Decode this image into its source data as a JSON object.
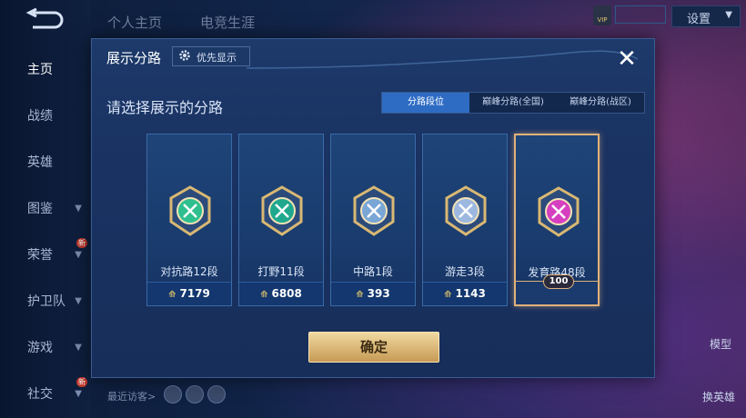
{
  "nav": {
    "top_tabs": [
      "个人主页",
      "电竞生涯"
    ],
    "sidebar": [
      {
        "label": "主页",
        "active": true,
        "chevron": false,
        "new": false
      },
      {
        "label": "战绩",
        "active": false,
        "chevron": false,
        "new": false
      },
      {
        "label": "英雄",
        "active": false,
        "chevron": false,
        "new": false
      },
      {
        "label": "图鉴",
        "active": false,
        "chevron": true,
        "new": false
      },
      {
        "label": "荣誉",
        "active": false,
        "chevron": true,
        "new": true
      },
      {
        "label": "护卫队",
        "active": false,
        "chevron": true,
        "new": false
      },
      {
        "label": "游戏",
        "active": false,
        "chevron": true,
        "new": false
      },
      {
        "label": "社交",
        "active": false,
        "chevron": true,
        "new": true
      }
    ],
    "new_badge": "新",
    "settings_label": "设置",
    "vip_label": "VIP",
    "right_labels": {
      "model": "模型",
      "change_hero": "换英雄"
    },
    "recent_visitors": "最近访客>"
  },
  "modal": {
    "title": "展示分路",
    "priority_label": "优先显示",
    "subtitle": "请选择展示的分路",
    "tabs": [
      {
        "label": "分路段位",
        "active": true
      },
      {
        "label": "巅峰分路(全国)",
        "active": false
      },
      {
        "label": "巅峰分路(战区)",
        "active": false
      }
    ],
    "cards": [
      {
        "name": "对抗路12段",
        "points": "7179",
        "emblem": "clash-lane-emblem",
        "color": "#2fbf8f",
        "selected": false
      },
      {
        "name": "打野11段",
        "points": "6808",
        "emblem": "jungle-emblem",
        "color": "#1fa88e",
        "selected": false
      },
      {
        "name": "中路1段",
        "points": "393",
        "emblem": "mid-lane-emblem",
        "color": "#7aa6d6",
        "selected": false
      },
      {
        "name": "游走3段",
        "points": "1143",
        "emblem": "roam-emblem",
        "color": "#9db8e0",
        "selected": false
      },
      {
        "name": "发育路48段",
        "points": "",
        "emblem": "farm-lane-emblem",
        "color": "#d63fc0",
        "selected": true,
        "badge": "100"
      }
    ],
    "confirm_label": "确定"
  }
}
